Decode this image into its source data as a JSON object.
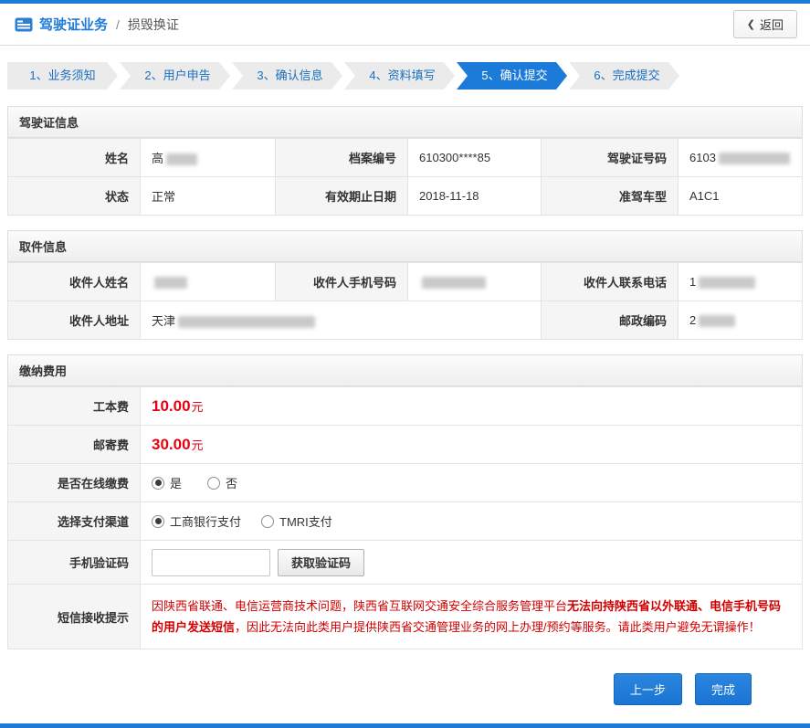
{
  "colors": {
    "accent": "#1c7ad8",
    "fee": "#e60012",
    "warning": "#d40000"
  },
  "header": {
    "title": "驾驶证业务",
    "separator": "/",
    "subtitle": "损毁换证",
    "back_icon": "❮",
    "back_label": "返回"
  },
  "steps": {
    "items": [
      {
        "label": "1、业务须知",
        "active": false
      },
      {
        "label": "2、用户申告",
        "active": false
      },
      {
        "label": "3、确认信息",
        "active": false
      },
      {
        "label": "4、资料填写",
        "active": false
      },
      {
        "label": "5、确认提交",
        "active": true
      },
      {
        "label": "6、完成提交",
        "active": false
      }
    ]
  },
  "license_info": {
    "title": "驾驶证信息",
    "rows": [
      [
        {
          "label": "姓名",
          "value": "高"
        },
        {
          "label": "档案编号",
          "value": "610300****85"
        },
        {
          "label": "驾驶证号码",
          "value": "6103"
        }
      ],
      [
        {
          "label": "状态",
          "value": "正常"
        },
        {
          "label": "有效期止日期",
          "value": "2018-11-18"
        },
        {
          "label": "准驾车型",
          "value": "A1C1"
        }
      ]
    ]
  },
  "pickup_info": {
    "title": "取件信息",
    "row1": [
      {
        "label": "收件人姓名",
        "value": ""
      },
      {
        "label": "收件人手机号码",
        "value": ""
      },
      {
        "label": "收件人联系电话",
        "value": "1"
      }
    ],
    "row2": {
      "address_label": "收件人地址",
      "address_value": "天津",
      "postcode_label": "邮政编码",
      "postcode_value": "2"
    }
  },
  "fees": {
    "title": "缴纳费用",
    "cost_label": "工本费",
    "cost_amount": "10.00",
    "cost_unit": "元",
    "postage_label": "邮寄费",
    "postage_amount": "30.00",
    "postage_unit": "元",
    "online_label": "是否在线缴费",
    "online_yes": "是",
    "online_no": "否",
    "online_selected": "是",
    "channel_label": "选择支付渠道",
    "channel_icbc": "工商银行支付",
    "channel_tmri": "TMRI支付",
    "channel_selected": "工商银行支付",
    "code_label": "手机验证码",
    "code_value": "",
    "get_code_label": "获取验证码",
    "sms_label": "短信接收提示",
    "sms_pre": "因陕西省联通、电信运营商技术问题，陕西省互联网交通安全综合服务管理平台",
    "sms_bold": "无法向持陕西省以外联通、电信手机号码的用户发送短信",
    "sms_post": "，因此无法向此类用户提供陕西省交通管理业务的网上办理/预约等服务。请此类用户避免无谓操作！"
  },
  "footer": {
    "prev_label": "上一步",
    "finish_label": "完成"
  }
}
